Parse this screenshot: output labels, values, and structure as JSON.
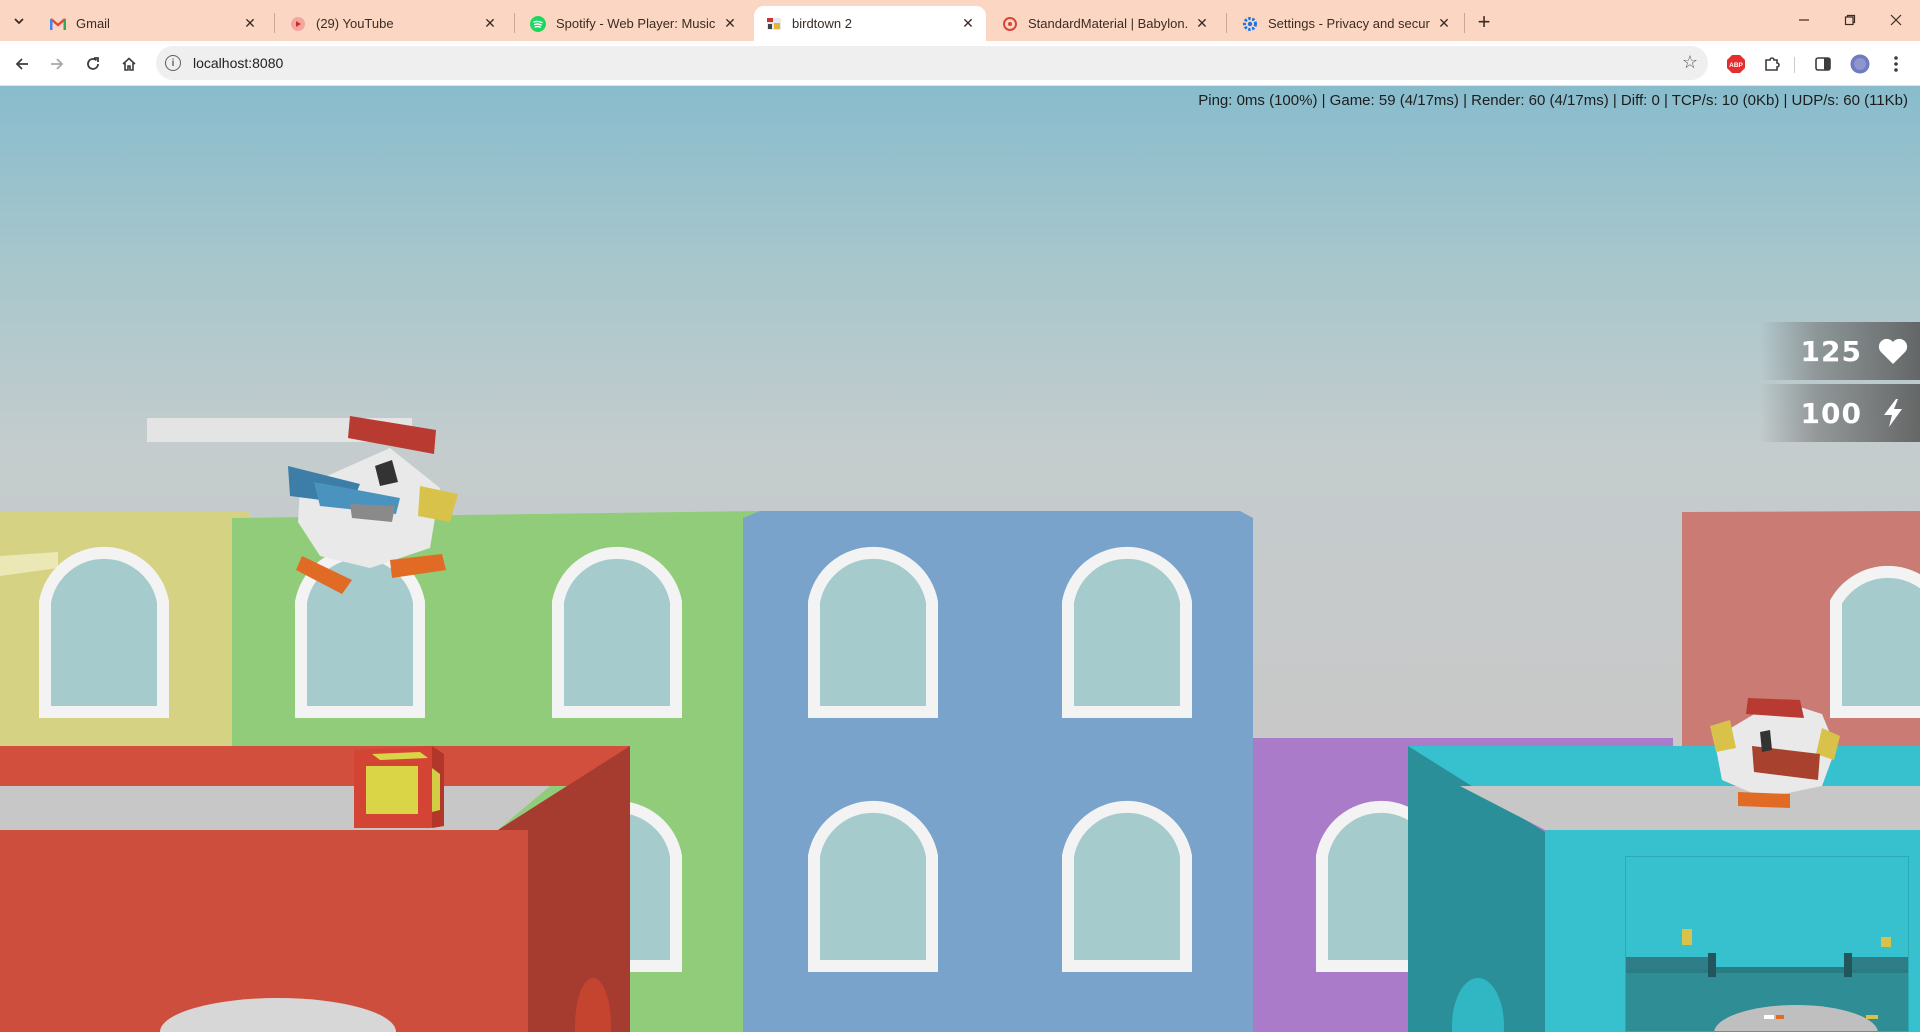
{
  "browser": {
    "tabs": [
      {
        "title": "Gmail",
        "icon": "gmail-icon",
        "active": false
      },
      {
        "title": "(29) YouTube",
        "icon": "youtube-icon",
        "active": false
      },
      {
        "title": "Spotify - Web Player: Music for",
        "icon": "spotify-icon",
        "active": false
      },
      {
        "title": "birdtown 2",
        "icon": "birdtown-icon",
        "active": true
      },
      {
        "title": "StandardMaterial | Babylon.js D",
        "icon": "babylon-icon",
        "active": false
      },
      {
        "title": "Settings - Privacy and security",
        "icon": "settings-gear-icon",
        "active": false
      }
    ],
    "url": "localhost:8080",
    "colors": {
      "tabstrip": "#fbd7c3",
      "active_tab": "#ffffff",
      "omnibox": "#efefef"
    }
  },
  "game": {
    "stats": "Ping: 0ms (100%) | Game: 59 (4/17ms) | Render: 60 (4/17ms) | Diff: 0 | TCP/s: 10 (0Kb) | UDP/s: 60 (11Kb)",
    "health": "125",
    "energy": "100",
    "icons": {
      "health": "heart-icon",
      "energy": "lightning-bolt-icon"
    },
    "colors": {
      "sky_top": "#88bccd",
      "building_yellow": "#d6d283",
      "building_green": "#90cc7a",
      "building_blue": "#7aa3cb",
      "building_purple": "#a97bc9",
      "building_pink": "#c97b74",
      "platform_red": "#cd4e3d",
      "platform_cyan": "#37c1cf",
      "window": "#a5cbcd"
    }
  }
}
